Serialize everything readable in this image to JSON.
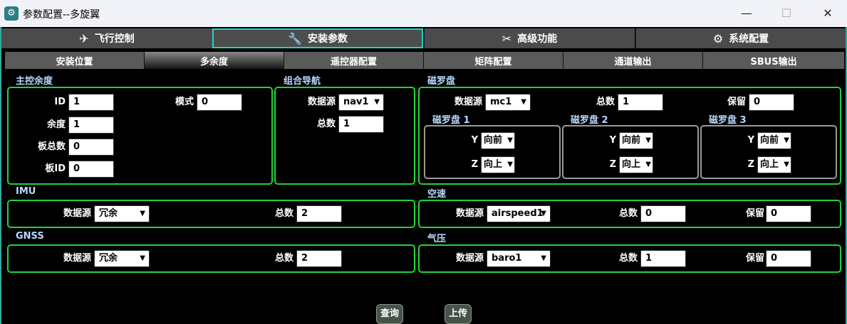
{
  "window": {
    "title": "参数配置--多旋翼",
    "app_icon": "gear-icon",
    "minimize": "—",
    "maximize": "☐",
    "close": "✕"
  },
  "main_tabs": [
    {
      "label": "飞行控制",
      "icon": "plane-icon"
    },
    {
      "label": "安装参数",
      "icon": "wrench-icon"
    },
    {
      "label": "高级功能",
      "icon": "tools-icon"
    },
    {
      "label": "系统配置",
      "icon": "gear-icon"
    }
  ],
  "sub_tabs": [
    "安装位置",
    "多余度",
    "遥控器配置",
    "矩阵配置",
    "通道输出",
    "SBUS输出"
  ],
  "main_ctrl": {
    "section": "主控余度",
    "id_label": "ID",
    "id_value": "1",
    "mode_label": "模式",
    "mode_value": "0",
    "redundancy_label": "余度",
    "redundancy_value": "1",
    "board_total_label": "板总数",
    "board_total_value": "0",
    "board_id_label": "板ID",
    "board_id_value": "0"
  },
  "nav": {
    "section": "组合导航",
    "source_label": "数据源",
    "source_value": "nav1",
    "total_label": "总数",
    "total_value": "1"
  },
  "compass": {
    "section": "磁罗盘",
    "source_label": "数据源",
    "source_value": "mc1",
    "total_label": "总数",
    "total_value": "1",
    "reserve_label": "保留",
    "reserve_value": "0",
    "units": [
      {
        "title": "磁罗盘 1",
        "y_label": "Y",
        "y_value": "向前",
        "z_label": "Z",
        "z_value": "向上"
      },
      {
        "title": "磁罗盘 2",
        "y_label": "Y",
        "y_value": "向前",
        "z_label": "Z",
        "z_value": "向上"
      },
      {
        "title": "磁罗盘 3",
        "y_label": "Y",
        "y_value": "向前",
        "z_label": "Z",
        "z_value": "向上"
      }
    ]
  },
  "imu": {
    "section": "IMU",
    "source_label": "数据源",
    "source_value": "冗余",
    "total_label": "总数",
    "total_value": "2"
  },
  "airspeed": {
    "section": "空速",
    "source_label": "数据源",
    "source_value": "airspeed1",
    "total_label": "总数",
    "total_value": "0",
    "reserve_label": "保留",
    "reserve_value": "0"
  },
  "gnss": {
    "section": "GNSS",
    "source_label": "数据源",
    "source_value": "冗余",
    "total_label": "总数",
    "total_value": "2"
  },
  "baro": {
    "section": "气压",
    "source_label": "数据源",
    "source_value": "baro1",
    "total_label": "总数",
    "total_value": "1",
    "reserve_label": "保留",
    "reserve_value": "0"
  },
  "buttons": {
    "query": "查询",
    "upload": "上传"
  },
  "colors": {
    "group_border": "#23d23a",
    "active_tab_border": "#1fd4c8",
    "section_title": "#b8d8ff"
  }
}
